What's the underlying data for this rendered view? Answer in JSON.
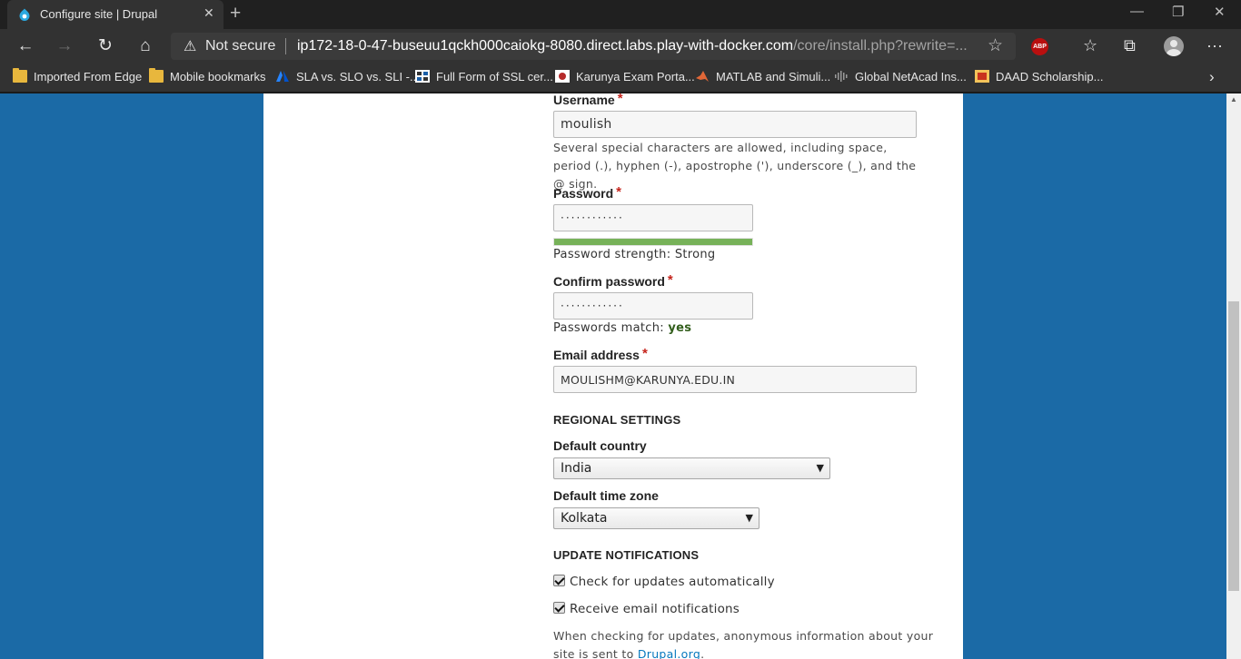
{
  "browser": {
    "tab_title": "Configure site | Drupal",
    "new_tab": "+",
    "security_label": "Not secure",
    "url_host": "ip172-18-0-47-buseuu1qckh000caiokg-8080.direct.labs.play-with-docker.com",
    "url_path": "/core/install.php?rewrite=...",
    "adblock_label": "ABP"
  },
  "bookmarks": [
    {
      "label": "Imported From Edge",
      "icon": "folder-icon"
    },
    {
      "label": "Mobile bookmarks",
      "icon": "folder-icon"
    },
    {
      "label": "SLA vs. SLO vs. SLI -...",
      "icon": "atlassian-icon"
    },
    {
      "label": "Full Form of SSL cer...",
      "icon": "grid-icon"
    },
    {
      "label": "Karunya Exam Porta...",
      "icon": "karunya-icon"
    },
    {
      "label": "MATLAB and Simuli...",
      "icon": "matlab-icon"
    },
    {
      "label": "Global NetAcad Ins...",
      "icon": "cisco-icon"
    },
    {
      "label": "DAAD Scholarship...",
      "icon": "daad-icon"
    }
  ],
  "form": {
    "username": {
      "label": "Username",
      "value": "moulish",
      "description": "Several special characters are allowed, including space, period (.), hyphen (-), apostrophe ('), underscore (_), and the @ sign."
    },
    "password": {
      "label": "Password",
      "value": "············",
      "strength_text": "Password strength: Strong",
      "strength": 1.0
    },
    "confirm_password": {
      "label": "Confirm password",
      "value": "············",
      "match_text": "Passwords match:",
      "match_value": "yes"
    },
    "email": {
      "label": "Email address",
      "value": "MOULISHM@KARUNYA.EDU.IN"
    },
    "regional_heading": "REGIONAL SETTINGS",
    "default_country": {
      "label": "Default country",
      "value": "India"
    },
    "default_timezone": {
      "label": "Default time zone",
      "value": "Kolkata"
    },
    "update_heading": "UPDATE NOTIFICATIONS",
    "check_updates": {
      "label": "Check for updates automatically",
      "checked": true
    },
    "email_notifications": {
      "label": "Receive email notifications",
      "checked": true
    },
    "update_note_1": "When checking for updates, anonymous information about your",
    "update_note_2": "site is sent to",
    "update_note_link": "Drupal.org",
    "update_note_end": "."
  },
  "colors": {
    "page_background": "#1b6aa6",
    "required_marker": "#c5241c",
    "strength_bar": "#77b259",
    "match_yes": "#325e1c",
    "link": "#0678be"
  }
}
